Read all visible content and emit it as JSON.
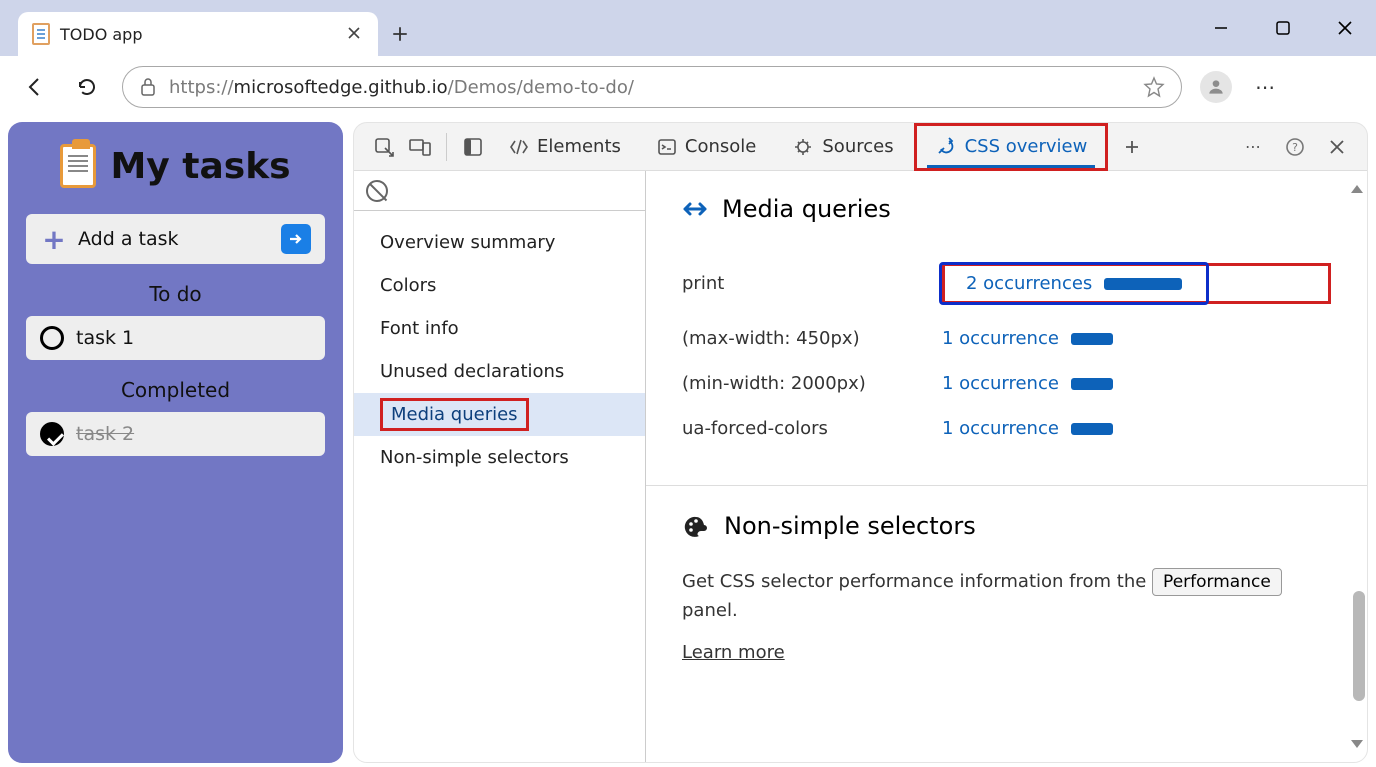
{
  "browser": {
    "tab_title": "TODO app",
    "url_prefix": "https://",
    "url_host": "microsoftedge.github.io",
    "url_path": "/Demos/demo-to-do/"
  },
  "page": {
    "title": "My tasks",
    "add_task_label": "Add a task",
    "sections": {
      "todo": "To do",
      "completed": "Completed"
    },
    "tasks": {
      "task1": "task 1",
      "task2": "task 2"
    }
  },
  "devtools": {
    "tabs": {
      "elements": "Elements",
      "console": "Console",
      "sources": "Sources",
      "css_overview": "CSS overview"
    },
    "nav": {
      "overview": "Overview summary",
      "colors": "Colors",
      "font": "Font info",
      "unused": "Unused declarations",
      "media": "Media queries",
      "nonsimple": "Non-simple selectors"
    },
    "media_queries": {
      "title": "Media queries",
      "rows": {
        "print": {
          "label": "print",
          "count": "2 occurrences"
        },
        "maxw": {
          "label": "(max-width: 450px)",
          "count": "1 occurrence"
        },
        "minw": {
          "label": "(min-width: 2000px)",
          "count": "1 occurrence"
        },
        "forced": {
          "label": "ua-forced-colors",
          "count": "1 occurrence"
        }
      }
    },
    "nonsimple": {
      "title": "Non-simple selectors",
      "desc_pre": "Get CSS selector performance information from the ",
      "perf_button": "Performance",
      "desc_post": " panel.",
      "learn": "Learn more"
    }
  }
}
